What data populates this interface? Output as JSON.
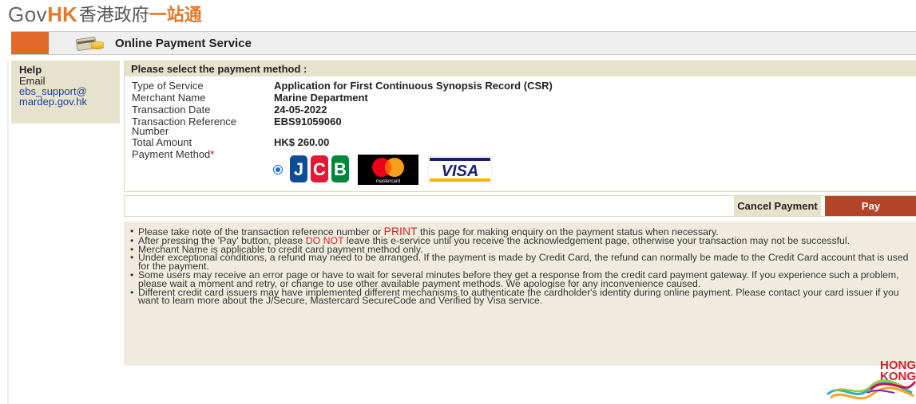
{
  "header": {
    "logo_gov": "Gov",
    "logo_hk": "HK",
    "logo_zh1": "香港政府",
    "logo_zh2": "一站通",
    "title": "Online Payment Service"
  },
  "help": {
    "heading": "Help",
    "label": "Email",
    "email_line1": "ebs_support@",
    "email_line2": "mardep.gov.hk"
  },
  "payment": {
    "heading": "Please select the payment method :",
    "fields": [
      {
        "label": "Type of Service",
        "value": "Application for First Continuous Synopsis Record (CSR)"
      },
      {
        "label": "Merchant Name",
        "value": "Marine Department"
      },
      {
        "label": "Transaction Date",
        "value": "24-05-2022"
      },
      {
        "label": "Transaction Reference",
        "label2": "Number",
        "value": "EBS91059060"
      },
      {
        "label": "Total Amount",
        "value": "HK$ 260.00"
      }
    ],
    "method_label": "Payment Method",
    "required_mark": "*",
    "methods": [
      "JCB",
      "mastercard",
      "VISA"
    ],
    "selected_method": "JCB"
  },
  "actions": {
    "cancel_label": "Cancel Payment",
    "pay_label": "Pay"
  },
  "notes": {
    "n1a": "Please take note of the transaction reference number or ",
    "n1b": "PRINT",
    "n1c": " this page for making enquiry on the payment status when necessary.",
    "n2a": "After pressing the 'Pay' button, please ",
    "n2b": "DO NOT",
    "n2c": " leave this e-service until you receive the acknowledgement page, otherwise your transaction may not be successful.",
    "n3": "Merchant Name is applicable to credit card payment method only.",
    "n4": "Under exceptional conditions, a refund may need to be arranged. If the payment is made by Credit Card, the refund can normally be made to the Credit Card account that is used for the payment.",
    "n5": "Some users may receive an error page or have to wait for several minutes before they get a response from the credit card payment gateway. If you experience such a problem, please wait a moment and retry, or change to use other available payment methods. We apologise for any inconvenience caused.",
    "n6": "Different credit card issuers may have implemented different mechanisms to authenticate the cardholder's identity during online payment. Please contact your card issuer if you want to learn more about the J/Secure, Mastercard SecureCode and Verified by Visa service."
  },
  "brand": {
    "line1": "HONG",
    "line2": "KONG"
  },
  "colors": {
    "accent_orange": "#e2692b",
    "pay_red": "#b5452a",
    "panel_beige": "#e6e2cc",
    "notice_red": "#d8202c"
  }
}
